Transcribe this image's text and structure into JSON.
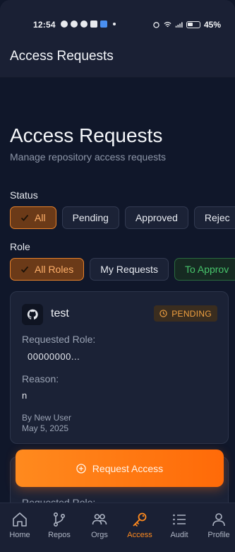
{
  "status_bar": {
    "time": "12:54",
    "battery": "45%"
  },
  "app_bar": {
    "title": "Access Requests"
  },
  "page": {
    "title": "Access Requests",
    "subtitle": "Manage repository access requests"
  },
  "filters": {
    "status_label": "Status",
    "status_options": [
      "All",
      "Pending",
      "Approved",
      "Rejec"
    ],
    "status_selected": "All",
    "role_label": "Role",
    "role_options": [
      "All Roles",
      "My Requests",
      "To Approv"
    ],
    "role_selected": "All Roles"
  },
  "request": {
    "repo": "test",
    "status": "PENDING",
    "requested_role_label": "Requested Role:",
    "requested_role_value": "00000000...",
    "reason_label": "Reason:",
    "reason_value": "n",
    "by": "By New User",
    "date": "May 5, 2025"
  },
  "second_card": {
    "requested_role_label": "Requested Role:"
  },
  "action": {
    "label": "Request Access"
  },
  "bottom_nav": [
    "Home",
    "Repos",
    "Orgs",
    "Access",
    "Audit",
    "Profile"
  ],
  "bottom_nav_active": "Access",
  "colors": {
    "accent": "#ff8a1e",
    "pending": "#f0a040",
    "approve_green": "#47c46b",
    "background": "#10172a"
  }
}
